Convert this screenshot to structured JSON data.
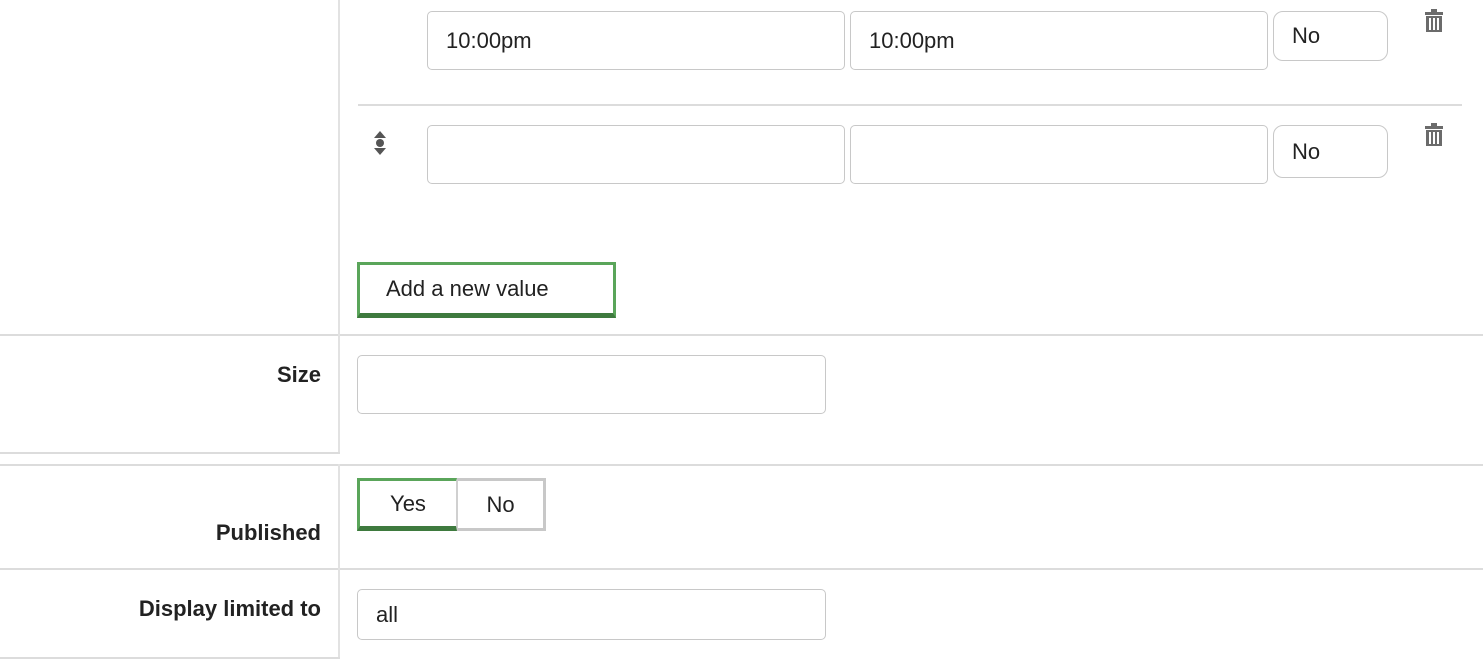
{
  "schedule_rows": [
    {
      "start_time": "10:00pm",
      "end_time": "10:00pm",
      "option": "No"
    },
    {
      "start_time": "",
      "end_time": "",
      "option": "No"
    }
  ],
  "add_button_label": "Add a new value",
  "fields": {
    "size_label": "Size",
    "size_value": "",
    "published_label": "Published",
    "published_yes": "Yes",
    "published_no": "No",
    "display_label": "Display limited to",
    "display_value": "all"
  },
  "icons": {
    "trash": "trash-icon",
    "drag": "drag-handle-icon"
  },
  "colors": {
    "accent": "#5aa55a",
    "accent_dark": "#3e7a3e",
    "border": "#c8c8c8",
    "separator": "#dcdcdc"
  }
}
